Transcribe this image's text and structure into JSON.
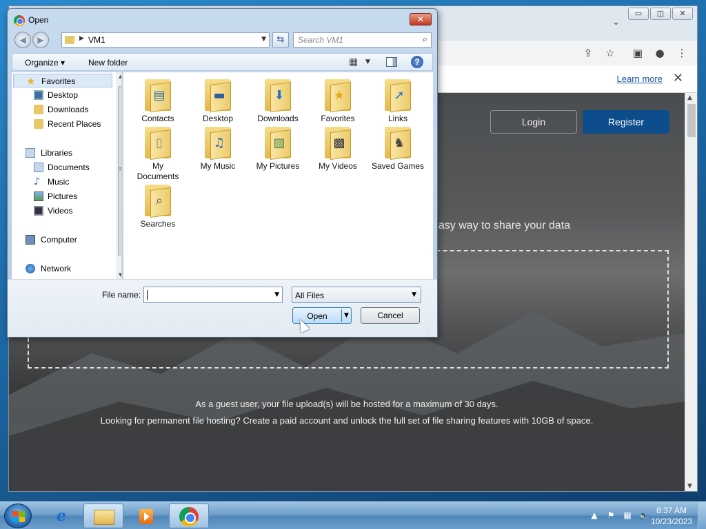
{
  "browser": {
    "infobar": {
      "learn_more": "Learn more"
    },
    "page": {
      "login": "Login",
      "register": "Register",
      "tagline": "easy way to share your data",
      "note_line1": "As a guest user, your file upload(s) will be hosted for a maximum of 30 days.",
      "note_line2": "Looking for permanent file hosting? Create a paid account and unlock the full set of file sharing features with 10GB of space."
    }
  },
  "dialog": {
    "title": "Open",
    "address": {
      "crumb": "VM1"
    },
    "search": {
      "placeholder": "Search VM1"
    },
    "toolbar": {
      "organize": "Organize",
      "new_folder": "New folder"
    },
    "nav": {
      "favorites": "Favorites",
      "desktop": "Desktop",
      "downloads": "Downloads",
      "recent_places": "Recent Places",
      "libraries": "Libraries",
      "documents": "Documents",
      "music": "Music",
      "pictures": "Pictures",
      "videos": "Videos",
      "computer": "Computer",
      "network": "Network"
    },
    "files": [
      {
        "label": "Contacts",
        "icon": "contacts-icon"
      },
      {
        "label": "Desktop",
        "icon": "desktop-icon"
      },
      {
        "label": "Downloads",
        "icon": "downloads-icon"
      },
      {
        "label": "Favorites",
        "icon": "favorites-icon"
      },
      {
        "label": "Links",
        "icon": "links-icon"
      },
      {
        "label": "My Documents",
        "icon": "documents-icon"
      },
      {
        "label": "My Music",
        "icon": "music-icon"
      },
      {
        "label": "My Pictures",
        "icon": "pictures-icon"
      },
      {
        "label": "My Videos",
        "icon": "videos-icon"
      },
      {
        "label": "Saved Games",
        "icon": "games-icon"
      },
      {
        "label": "Searches",
        "icon": "searches-icon"
      }
    ],
    "file_name_label": "File name:",
    "file_name_value": "",
    "filter": "All Files",
    "open": "Open",
    "cancel": "Cancel"
  },
  "taskbar": {
    "time": "8:37 AM",
    "date": "10/23/2023"
  }
}
